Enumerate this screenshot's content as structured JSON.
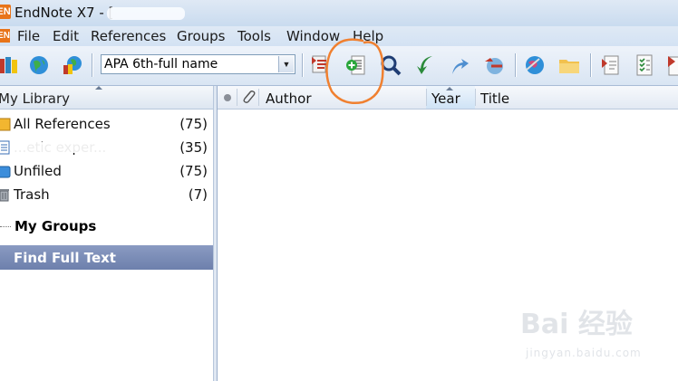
{
  "window": {
    "title": "EndNote X7 - [",
    "app_icon_text": "EN"
  },
  "menu": {
    "items": [
      "File",
      "Edit",
      "References",
      "Groups",
      "Tools",
      "Window",
      "Help"
    ]
  },
  "toolbar": {
    "style_select": {
      "value": "APA 6th-full name"
    }
  },
  "left_panel": {
    "header": "My Library",
    "groups": [
      {
        "label": "All References",
        "count": "(75)",
        "icon": "all-references-icon"
      },
      {
        "label": "...etic exper...",
        "count": "(35)",
        "icon": "group-set-icon"
      },
      {
        "label": "Unfiled",
        "count": "(75)",
        "icon": "unfiled-icon"
      },
      {
        "label": "Trash",
        "count": "(7)",
        "icon": "trash-icon"
      }
    ],
    "my_groups_label": "My Groups",
    "find_full_text_label": "Find Full Text"
  },
  "reference_list": {
    "columns": [
      "Author",
      "Year",
      "Title"
    ]
  },
  "annotation": {
    "color": "#f08030"
  },
  "watermark": {
    "brand": "Bai 经验",
    "url": "jingyan.baidu.com"
  }
}
